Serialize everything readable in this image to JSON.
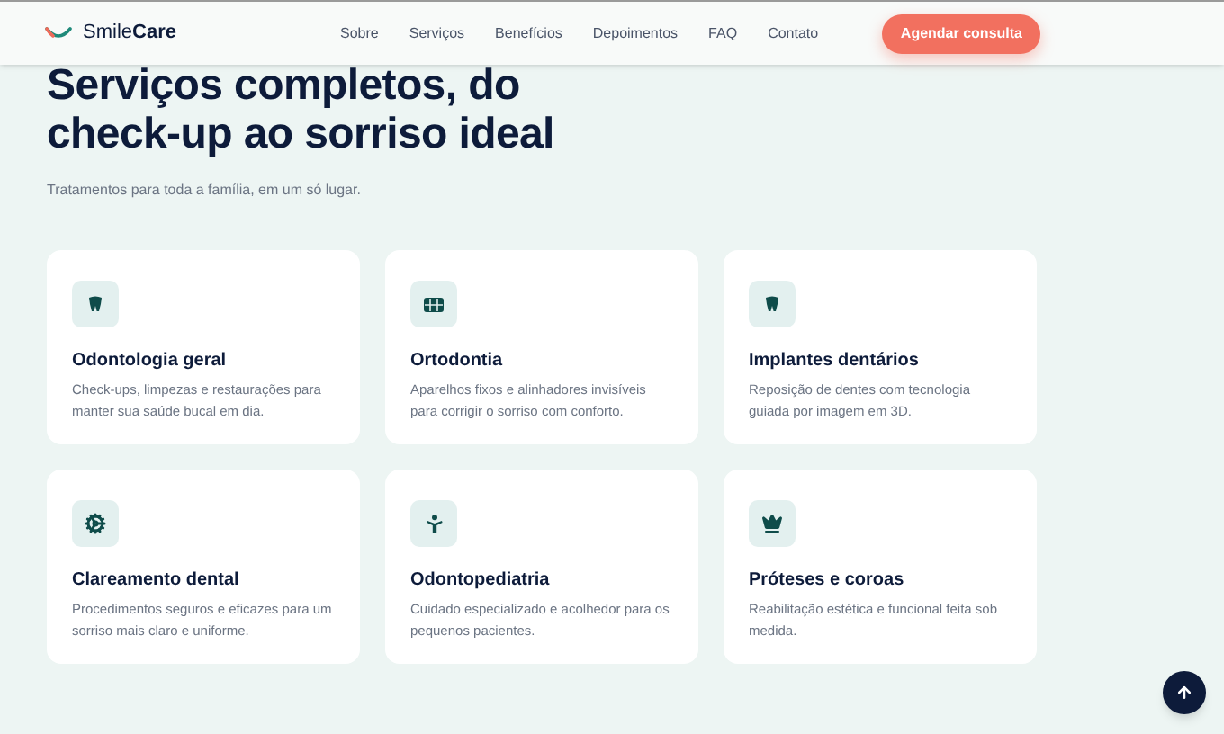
{
  "header": {
    "logo": {
      "prefix": "Smile",
      "suffix": "Care"
    },
    "nav": [
      "Sobre",
      "Serviços",
      "Benefícios",
      "Depoimentos",
      "FAQ",
      "Contato"
    ],
    "cta": "Agendar consulta"
  },
  "hero": {
    "title_lines": [
      "Serviços completos, do",
      "check-up ao sorriso ideal"
    ],
    "subtitle": "Tratamentos para toda a família, em um só lugar."
  },
  "services": [
    {
      "title": "Odontologia geral",
      "description": "Check-ups, limpezas e restaurações para manter sua saúde bucal em dia."
    },
    {
      "title": "Ortodontia",
      "description": "Aparelhos fixos e alinhadores invisíveis para corrigir o sorriso com conforto."
    },
    {
      "title": "Implantes dentários",
      "description": "Reposição de dentes com tecnologia guiada por imagem em 3D."
    },
    {
      "title": "Clareamento dental",
      "description": "Procedimentos seguros e eficazes para um sorriso mais claro e uniforme."
    },
    {
      "title": "Odontopediatria",
      "description": "Cuidado especializado e acolhedor para os pequenos pacientes."
    },
    {
      "title": "Próteses e coroas",
      "description": "Reabilitação estética e funcional feita sob medida."
    }
  ]
}
